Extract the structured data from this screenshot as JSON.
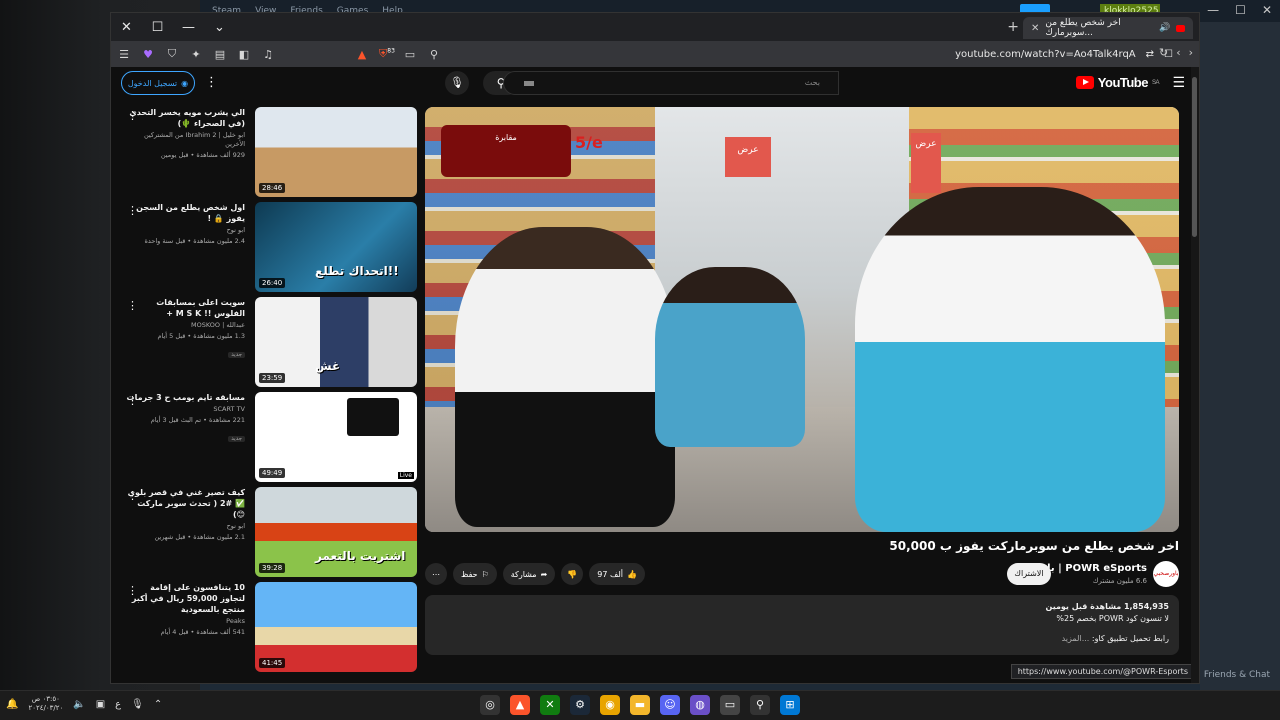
{
  "desktop": {
    "steam_menu": [
      "Steam",
      "View",
      "Friends",
      "Games",
      "Help"
    ],
    "steam_user": "klokklo2525",
    "friends_chat": "Friends & Chat"
  },
  "browser": {
    "tab_title": "اخر شخص يطلع من سوبرمارك...",
    "url": "youtube.com/watch?v=Ao4Talk4rqA",
    "extension_badge": "83",
    "status_url": "https://www.youtube.com/@POWR-Esports"
  },
  "youtube": {
    "logo_text": "YouTube",
    "logo_region": "SA",
    "search_placeholder": "بحث",
    "sign_in": "تسجيل الدخول",
    "video": {
      "title": "اخر شخص يطلع من سوبرماركت يفوز ب 50,000",
      "overlay_text": "مقابرة",
      "overlay_score": "5/e",
      "promo_text": "عرض",
      "channel_name": "POWR eSports | باور",
      "channel_subs": "6.6 مليون مشترك",
      "avatar_text": "باورصحبي",
      "subscribe": "الاشتراك",
      "like_count": "97 ألف",
      "share": "مشاركة",
      "save": "حفظ",
      "views": "1,854,935 مشاهدة",
      "age": "قبل يومين",
      "desc_line": "لا تنسون كود POWR بخصم 25%",
      "desc_link": "رابط تحميل تطبيق كاو:",
      "desc_more": "...المزيد"
    },
    "recommendations": [
      {
        "title": "الي يشرب مويه يخسر التحدي (في الصحراء 🌵)",
        "channel": "ابو خليل | Ibrahim 2 من المشتركين الأخرين",
        "meta": "929 ألف مشاهدة • قبل يومين",
        "duration": "28:46",
        "caption": ""
      },
      {
        "title": "اول شخص يطلع من السجن يفوز 🔒 !",
        "channel": "ابو نوح",
        "meta": "2.4 مليون مشاهدة • قبل سنة واحدة",
        "duration": "26:40",
        "caption": "اتحداك تطلع!!"
      },
      {
        "title": "سويت اعلى بمسابقات الفلوس !! M S K + ",
        "channel": "عبدالله | MOSKOO",
        "meta": "1.3 مليون مشاهدة • قبل 5 أيام",
        "duration": "23:59",
        "caption": "غش"
      },
      {
        "title": "مسابقه تايم بومب ح 3 جرمات",
        "channel": "SCART TV",
        "meta": "221 مشاهدة • تم البث قبل 3 أيام",
        "duration": "49:49",
        "caption": ""
      },
      {
        "title": "كيف تصير غني في قصر بلوي ✅ #2 ( تحدث سوبر ماركت 😊)",
        "channel": "ابو نوح",
        "meta": "2.1 مليون مشاهدة • قبل شهرين",
        "duration": "39:28",
        "caption": "اشتريت بالتعمر"
      },
      {
        "title": "10 يتنافسون على إقامة لتجاوز 59,000 ريال في أكبر منتجع بالسعودية",
        "channel": "Peaks",
        "meta": "541 ألف مشاهدة • قبل 4 أيام",
        "duration": "41:45",
        "caption": ""
      }
    ]
  },
  "taskbar": {
    "time": "٠٣:٥٠ ص",
    "date": "٢٠٢٤/٠٣/٢٠",
    "lang": "ع"
  }
}
